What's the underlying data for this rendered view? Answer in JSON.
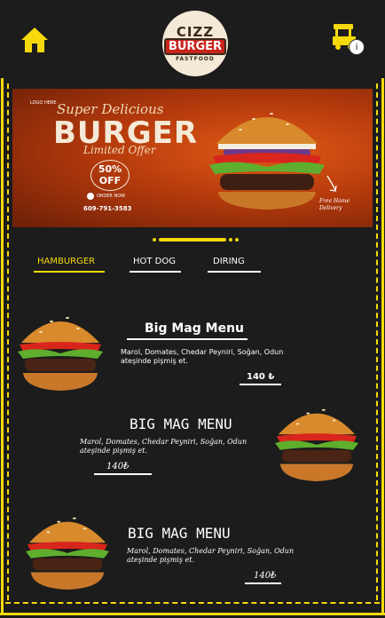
{
  "header": {
    "home_icon": "home-icon",
    "logo": {
      "line1": "CIZZ",
      "line2": "BURGER",
      "line3": "FASTFOOD"
    },
    "cart_icon": "food-cart-icon",
    "cart_badge": "i"
  },
  "banner": {
    "logo_text": "LOGO HERE",
    "super": "Super Delicious",
    "title": "BURGER",
    "limited": "Limited Offer",
    "discount_pct": "50%",
    "discount_word": "OFF",
    "order_now": "ORDER NOW",
    "phone": "609-791-3583",
    "free_home": "Free Home",
    "delivery": "Delivery"
  },
  "tabs": [
    {
      "label": "HAMBURGER",
      "active": true
    },
    {
      "label": "HOT DOG",
      "active": false
    },
    {
      "label": "DIRING",
      "active": false
    }
  ],
  "menu": [
    {
      "title": "Big Mag Menu",
      "desc": "Marol, Domates, Chedar Peyniri, Soğan, Odun ateşinde pişmiş et.",
      "price": "140 ₺"
    },
    {
      "title": "BIG MAG MENU",
      "desc": "Marol, Domates, Chedar Peyniri, Soğan, Odun ateşinde pişmiş et.",
      "price": "140₺"
    },
    {
      "title": "BIG MAG MENU",
      "desc": "Marol, Domates, Chedar Peyniri, Soğan, Odun ateşinde pişmiş et.",
      "price": "140₺"
    }
  ],
  "colors": {
    "accent": "#f5d90a",
    "background": "#1c1c1c"
  }
}
